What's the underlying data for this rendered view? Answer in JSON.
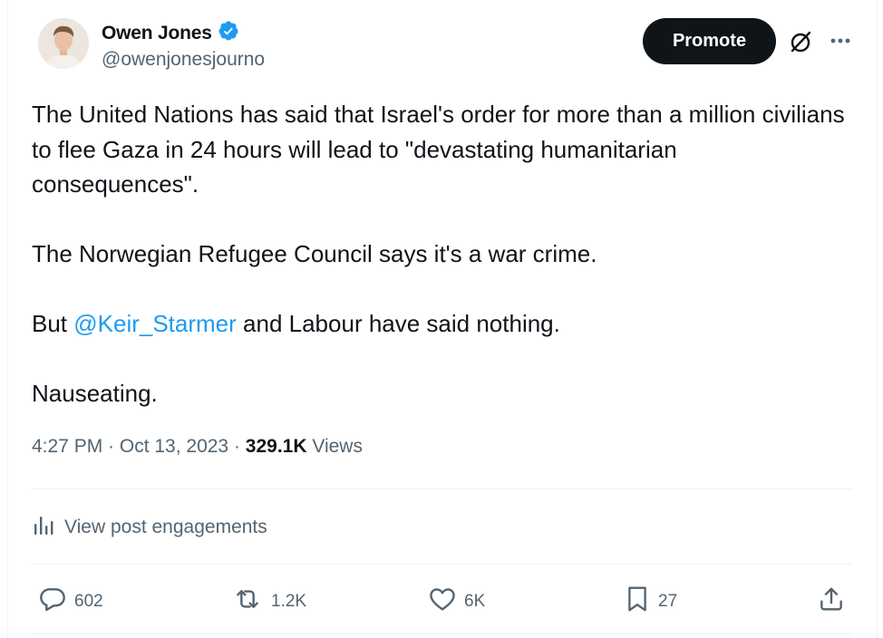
{
  "author": {
    "name": "Owen Jones",
    "handle": "@owenjonesjourno"
  },
  "header": {
    "promote_label": "Promote"
  },
  "tweet": {
    "line1": "The United Nations has said that Israel's order for more than a million civilians to flee Gaza in 24 hours will lead to \"devastating humanitarian consequences\".",
    "line2": "The Norwegian Refugee Council says it's a war crime.",
    "line3_before": "But ",
    "line3_mention": "@Keir_Starmer",
    "line3_after": " and Labour have said nothing.",
    "line4": "Nauseating."
  },
  "meta": {
    "time_date": "4:27 PM · Oct 13, 2023 · ",
    "views_count": "329.1K",
    "views_label": " Views"
  },
  "engagements_label": "View post engagements",
  "actions": {
    "replies": "602",
    "reposts": "1.2K",
    "likes": "6K",
    "bookmarks": "27"
  },
  "colors": {
    "link": "#1d9bf0",
    "verified": "#1d9bf0",
    "secondary_text": "#536471",
    "primary_text": "#0f1419"
  },
  "icons": [
    "verified-badge-icon",
    "grok-icon",
    "more-icon",
    "analytics-icon",
    "reply-icon",
    "repost-icon",
    "like-icon",
    "bookmark-icon",
    "share-icon"
  ]
}
